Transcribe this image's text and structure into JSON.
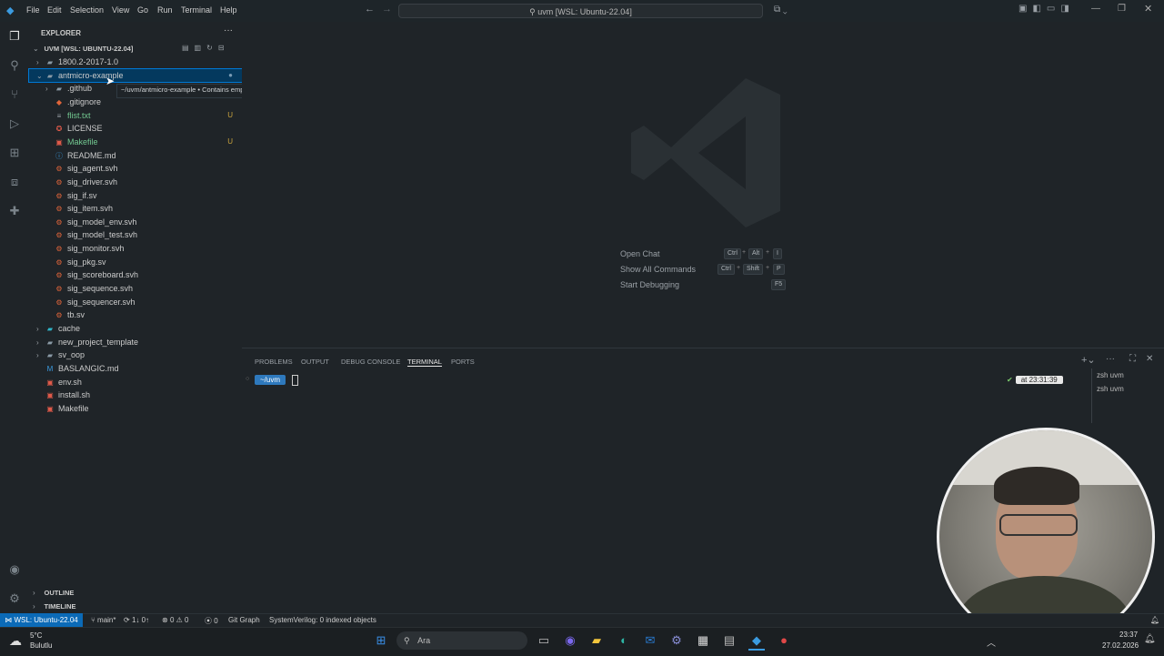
{
  "titlebar": {
    "menus": [
      "File",
      "Edit",
      "Selection",
      "View",
      "Go",
      "Run",
      "Terminal",
      "Help"
    ],
    "search_text": "uvm [WSL: Ubuntu-22.04]"
  },
  "sidebar": {
    "title": "EXPLORER",
    "root": "UVM [WSL: UBUNTU-22.04]",
    "rows": [
      {
        "label": "1800.2-2017-1.0",
        "kind": "folder",
        "depth": 0,
        "expanded": false
      },
      {
        "label": "antmicro-example",
        "kind": "folder",
        "depth": 0,
        "expanded": true,
        "selected": true
      },
      {
        "label": ".github",
        "kind": "folder",
        "depth": 1,
        "expanded": false
      },
      {
        "label": ".gitignore",
        "kind": "git",
        "depth": 1
      },
      {
        "label": "flist.txt",
        "kind": "txt",
        "depth": 1,
        "badge": "U",
        "color": "#73c991"
      },
      {
        "label": "LICENSE",
        "kind": "license",
        "depth": 1
      },
      {
        "label": "Makefile",
        "kind": "make",
        "depth": 1,
        "badge": "U",
        "color": "#73c991"
      },
      {
        "label": "README.md",
        "kind": "info",
        "depth": 1
      },
      {
        "label": "sig_agent.svh",
        "kind": "sv",
        "depth": 1
      },
      {
        "label": "sig_driver.svh",
        "kind": "sv",
        "depth": 1
      },
      {
        "label": "sig_if.sv",
        "kind": "sv",
        "depth": 1
      },
      {
        "label": "sig_item.svh",
        "kind": "sv",
        "depth": 1
      },
      {
        "label": "sig_model_env.svh",
        "kind": "sv",
        "depth": 1
      },
      {
        "label": "sig_model_test.svh",
        "kind": "sv",
        "depth": 1
      },
      {
        "label": "sig_monitor.svh",
        "kind": "sv",
        "depth": 1
      },
      {
        "label": "sig_pkg.sv",
        "kind": "sv",
        "depth": 1
      },
      {
        "label": "sig_scoreboard.svh",
        "kind": "sv",
        "depth": 1
      },
      {
        "label": "sig_sequence.svh",
        "kind": "sv",
        "depth": 1
      },
      {
        "label": "sig_sequencer.svh",
        "kind": "sv",
        "depth": 1
      },
      {
        "label": "tb.sv",
        "kind": "sv",
        "depth": 1
      },
      {
        "label": "cache",
        "kind": "folder-cache",
        "depth": 0,
        "expanded": false
      },
      {
        "label": "new_project_template",
        "kind": "folder",
        "depth": 0,
        "expanded": false
      },
      {
        "label": "sv_oop",
        "kind": "folder",
        "depth": 0,
        "expanded": false
      },
      {
        "label": "BASLANGIC.md",
        "kind": "md",
        "depth": 0
      },
      {
        "label": "env.sh",
        "kind": "sh",
        "depth": 0
      },
      {
        "label": "install.sh",
        "kind": "sh",
        "depth": 0
      },
      {
        "label": "Makefile",
        "kind": "make",
        "depth": 0
      }
    ],
    "tooltip": "~/uvm/antmicro-example • Contains emphasized items",
    "outline": "OUTLINE",
    "timeline": "TIMELINE"
  },
  "editor": {
    "commands": [
      {
        "label": "Open Chat",
        "keys": [
          "Ctrl",
          "+",
          "Alt",
          "+",
          "I"
        ]
      },
      {
        "label": "Show All Commands",
        "keys": [
          "Ctrl",
          "+",
          "Shift",
          "+",
          "P"
        ]
      },
      {
        "label": "Start Debugging",
        "keys": [
          "F5"
        ]
      }
    ]
  },
  "panel": {
    "tabs": [
      "PROBLEMS",
      "OUTPUT",
      "DEBUG CONSOLE",
      "TERMINAL",
      "PORTS"
    ],
    "active_tab": "TERMINAL",
    "prompt": "~/uvm",
    "time": "at 23:31:39",
    "terminals": [
      "zsh uvm",
      "zsh uvm"
    ]
  },
  "status": {
    "remote": "WSL: Ubuntu-22.04",
    "branch": "main*",
    "sync": "1↓ 0↑",
    "errors": "0",
    "warnings": "0",
    "ports": "0",
    "git_graph": "Git Graph",
    "sv_info": "SystemVerilog: 0 indexed objects"
  },
  "taskbar": {
    "weather_temp": "5°C",
    "weather_desc": "Bulutlu",
    "search_placeholder": "Ara",
    "time": "23:37",
    "date": "27.02.2026"
  }
}
